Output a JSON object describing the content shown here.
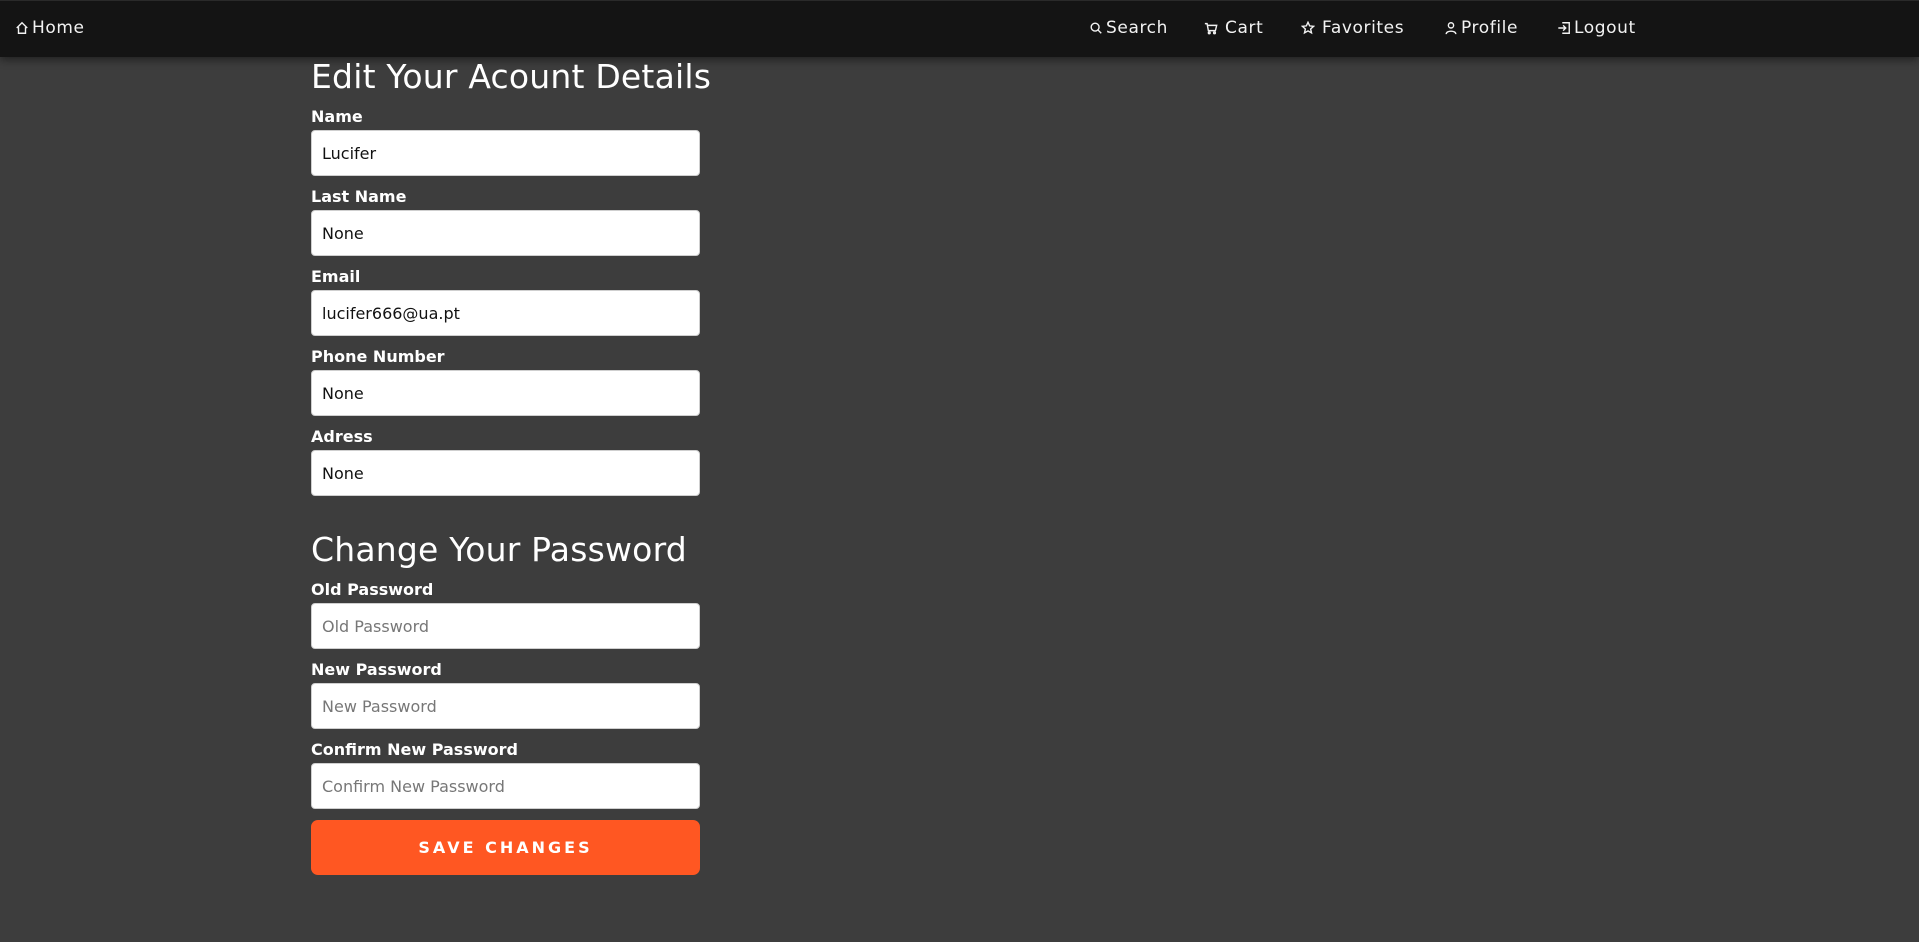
{
  "navbar": {
    "home_label": "Home",
    "search_label": "Search",
    "cart_label": "Cart",
    "favorites_label": "Favorites",
    "profile_label": "Profile",
    "logout_label": "Logout"
  },
  "account": {
    "title": "Edit Your Acount Details",
    "fields": [
      {
        "label": "Name",
        "value": "Lucifer"
      },
      {
        "label": "Last Name",
        "value": "None"
      },
      {
        "label": "Email",
        "value": "lucifer666@ua.pt"
      },
      {
        "label": "Phone Number",
        "value": "None"
      },
      {
        "label": "Adress",
        "value": "None"
      }
    ]
  },
  "password": {
    "title": "Change Your Password",
    "fields": [
      {
        "label": "Old Password",
        "placeholder": "Old Password"
      },
      {
        "label": "New Password",
        "placeholder": "New Password"
      },
      {
        "label": "Confirm New Password",
        "placeholder": "Confirm New Password"
      }
    ]
  },
  "save_button_label": "Save Changes",
  "colors": {
    "background": "#3d3d3d",
    "navbar": "#141414",
    "accent": "#ff5722"
  }
}
